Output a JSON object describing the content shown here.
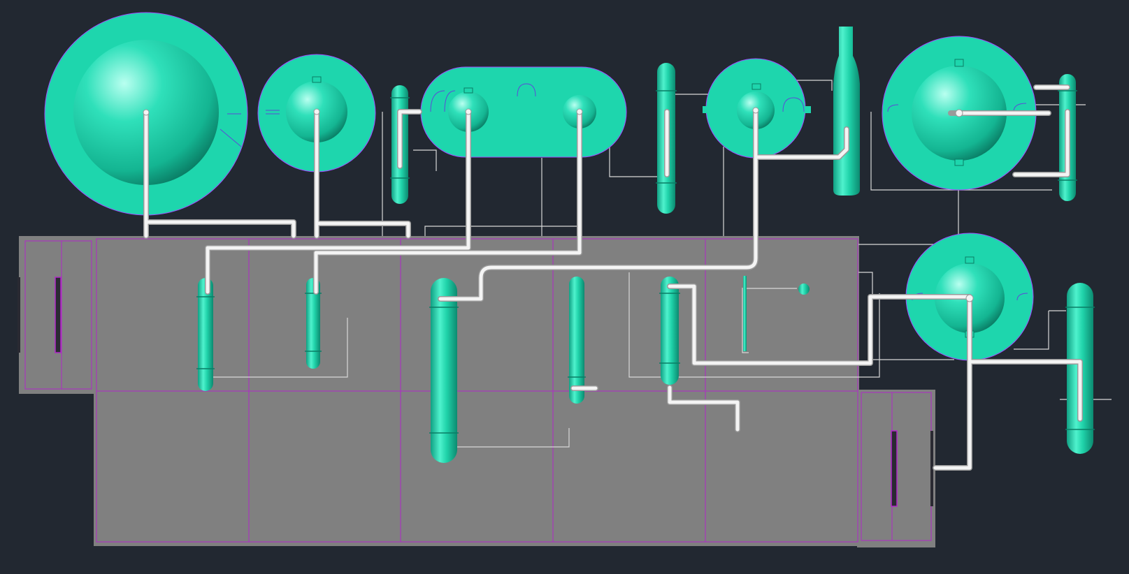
{
  "colors": {
    "background": "#222831",
    "equipment": "#1ed6ad",
    "equipment_dark": "#119a7c",
    "equipment_light": "#8ff6df",
    "pad_outline": "#a14cff",
    "grid_line": "#b128c9",
    "slab": "#808080",
    "pipe": "#e9e9e9",
    "pipe_shadow": "#a8a8a8",
    "line": "#d8d8d8"
  },
  "scene": {
    "view": "top",
    "equipment": [
      {
        "id": "sphere-1",
        "kind": "sphere-tank"
      },
      {
        "id": "sphere-2",
        "kind": "sphere-tank"
      },
      {
        "id": "sphere-3",
        "kind": "sphere-tank"
      },
      {
        "id": "sphere-4",
        "kind": "sphere-tank"
      },
      {
        "id": "sphere-5",
        "kind": "sphere-tank"
      },
      {
        "id": "sphere-6",
        "kind": "sphere-tank"
      },
      {
        "id": "sphere-7",
        "kind": "sphere-tank"
      },
      {
        "id": "column-1",
        "kind": "vertical-vessel"
      },
      {
        "id": "column-2",
        "kind": "vertical-vessel"
      },
      {
        "id": "column-3",
        "kind": "vertical-vessel"
      },
      {
        "id": "column-4",
        "kind": "vertical-vessel"
      },
      {
        "id": "column-5",
        "kind": "vertical-vessel"
      },
      {
        "id": "column-6",
        "kind": "vertical-vessel"
      },
      {
        "id": "column-7",
        "kind": "vertical-vessel"
      },
      {
        "id": "column-8",
        "kind": "vertical-vessel"
      },
      {
        "id": "column-9",
        "kind": "vertical-vessel"
      },
      {
        "id": "column-10",
        "kind": "vertical-vessel"
      },
      {
        "id": "column-11",
        "kind": "vertical-vessel"
      },
      {
        "id": "column-12",
        "kind": "vertical-vessel"
      },
      {
        "id": "valve-1",
        "kind": "small-instrument"
      }
    ]
  }
}
